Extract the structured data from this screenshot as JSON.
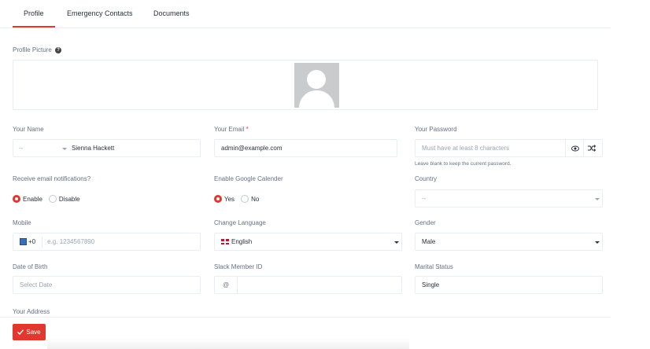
{
  "tabs": [
    {
      "label": "Profile",
      "active": true
    },
    {
      "label": "Emergency Contacts",
      "active": false
    },
    {
      "label": "Documents",
      "active": false
    }
  ],
  "profile_picture": {
    "label": "Profile Picture"
  },
  "name": {
    "label": "Your Name",
    "salutation": "--",
    "value": "Sienna Hackett"
  },
  "email": {
    "label": "Your Email",
    "required_mark": "*",
    "value": "admin@example.com"
  },
  "password": {
    "label": "Your Password",
    "placeholder": "Must have at least 8 characters",
    "help": "Leave blank to keep the current password."
  },
  "email_notifications": {
    "label": "Receive email notifications?",
    "options": [
      "Enable",
      "Disable"
    ],
    "selected": "Enable"
  },
  "google_calendar": {
    "label": "Enable Google Calender",
    "options": [
      "Yes",
      "No"
    ],
    "selected": "Yes"
  },
  "country": {
    "label": "Country",
    "value": "--"
  },
  "mobile": {
    "label": "Mobile",
    "code": "+0",
    "placeholder": "e.g. 1234567890"
  },
  "language": {
    "label": "Change Language",
    "value": "English"
  },
  "gender": {
    "label": "Gender",
    "value": "Male"
  },
  "dob": {
    "label": "Date of Birth",
    "placeholder": "Select Date"
  },
  "slack": {
    "label": "Slack Member ID",
    "prefix": "@"
  },
  "marital": {
    "label": "Marital Status",
    "value": "Single"
  },
  "address": {
    "label": "Your Address"
  },
  "save_button": {
    "label": "Save"
  },
  "colors": {
    "accent": "#e0382e",
    "border": "#e8eef3",
    "text": "#28313c",
    "muted": "#667085"
  }
}
